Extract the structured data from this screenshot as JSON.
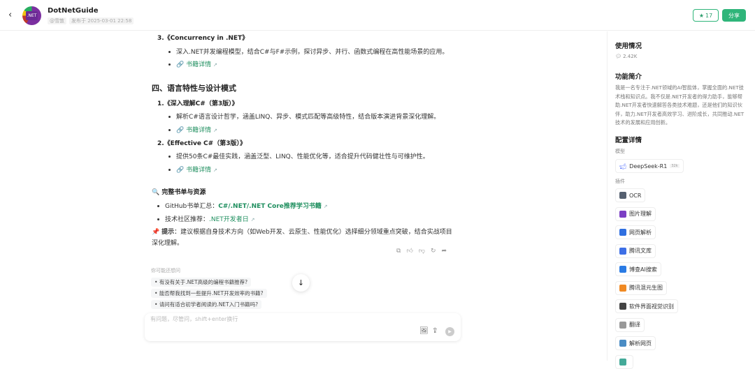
{
  "header": {
    "back_icon": "chevron-left-icon",
    "avatar_text": ".NET",
    "bot_name": "DotNetGuide",
    "author": "@雪敦",
    "published": "发布于 2025-03-01 22:58",
    "star_count": "17",
    "share_label": "分享"
  },
  "chat": {
    "item3_title": "3.《Concurrency in .NET》",
    "item3_desc": "深入.NET并发编程模型，结合C#与F#示例，探讨异步、并行、函数式编程在高性能场景的应用。",
    "book_link": "书籍详情",
    "section4_heading": "四、语言特性与设计模式",
    "s4_item1_title": "1.《深入理解C#（第3版）》",
    "s4_item1_desc": "解析C#语言设计哲学，涵盖LINQ、异步、模式匹配等高级特性，结合版本演进背景深化理解。",
    "s4_item2_title": "2.《Effective C#（第3版）》",
    "s4_item2_desc": "提供50条C#最佳实践，涵盖泛型、LINQ、性能优化等，适合提升代码健壮性与可维护性。",
    "resources_heading": "完整书单与资源",
    "github_label": "GitHub书单汇总：",
    "github_link": "C#/.NET/.NET Core推荐学习书籍",
    "community_label": "技术社区推荐：",
    "community_link": ".NET开发者日",
    "tip_label": "提示",
    "tip_text": "：建议根据自身技术方向（如Web开发、云原生、性能优化）选择细分领域重点突破，结合实战项目",
    "tip_text2": "深化理解。"
  },
  "suggestions": {
    "label": "你可能还想问",
    "items": [
      "有没有关于.NET高级的编程书籍推荐?",
      "能否帮我找到一些提升.NET开发效率的书籍?",
      "请问有适合初学者阅读的.NET入门书籍吗?"
    ]
  },
  "input": {
    "placeholder": "有问题，尽管问，shift+enter换行"
  },
  "sidebar": {
    "usage_heading": "使用情况",
    "usage_count": "2.42K",
    "intro_heading": "功能简介",
    "intro_text": "我是一名专注于.NET领域的AI智能体，掌握全面的.NET技术栈和知识点。我不仅是.NET开发者的得力助手，能够帮助.NET开发者快速解答各类技术难题，还是他们的知识伙伴，助力.NET开发者高效学习、进阶成长，共同推动.NET技术的发展和应用创新。",
    "config_heading": "配置详情",
    "model_label": "模型",
    "model_name": "DeepSeek-R1",
    "model_tag": "32k",
    "plugins_label": "插件",
    "plugins": [
      {
        "name": "OCR",
        "color": "#556070"
      },
      {
        "name": "图片理解",
        "color": "#7b3fc4"
      },
      {
        "name": "网页解析",
        "color": "#2f6fe0"
      },
      {
        "name": "腾讯文库",
        "color": "#3d6fe6"
      },
      {
        "name": "博查AI搜索",
        "color": "#2a7be4"
      },
      {
        "name": "腾讯混元生图",
        "color": "#f08a24"
      },
      {
        "name": "软件界面视觉识别",
        "color": "#444"
      },
      {
        "name": "翻译",
        "color": "#999"
      },
      {
        "name": "解析网页",
        "color": "#4a8cc4"
      },
      {
        "name": "",
        "color": "#4a9"
      }
    ]
  }
}
